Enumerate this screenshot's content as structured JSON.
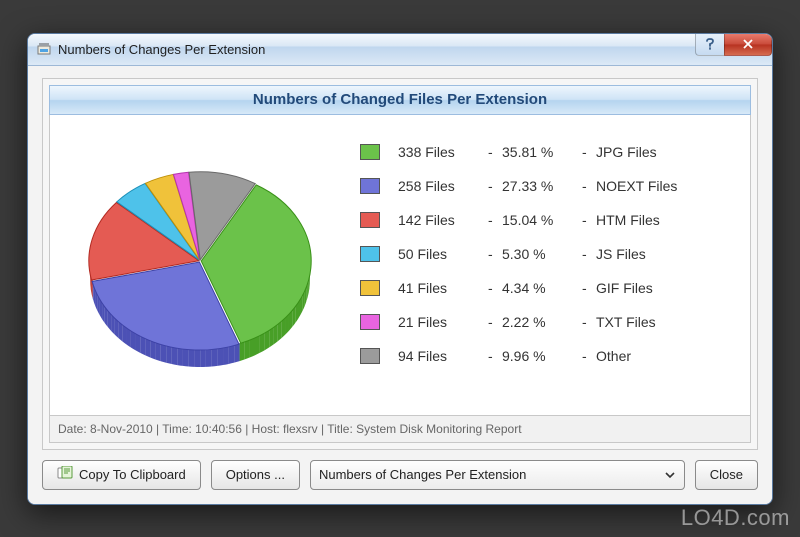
{
  "window": {
    "title": "Numbers of Changes Per Extension"
  },
  "panel": {
    "title": "Numbers of Changed Files Per Extension"
  },
  "colors": {
    "jpg": "#6bc24a",
    "noext": "#6f74d8",
    "htm": "#e45b53",
    "js": "#4ec2ea",
    "gif": "#f0c23a",
    "txt": "#e964e0",
    "other": "#9b9b9b"
  },
  "chart_data": {
    "type": "pie",
    "title": "Numbers of Changed Files Per Extension",
    "series": [
      {
        "key": "jpg",
        "files": 338,
        "files_label": "338 Files",
        "pct": 35.81,
        "pct_label": "35.81 %",
        "label": "JPG Files"
      },
      {
        "key": "noext",
        "files": 258,
        "files_label": "258 Files",
        "pct": 27.33,
        "pct_label": "27.33 %",
        "label": "NOEXT Files"
      },
      {
        "key": "htm",
        "files": 142,
        "files_label": "142 Files",
        "pct": 15.04,
        "pct_label": "15.04 %",
        "label": "HTM Files"
      },
      {
        "key": "js",
        "files": 50,
        "files_label": "50 Files",
        "pct": 5.3,
        "pct_label": "5.30 %",
        "label": "JS Files"
      },
      {
        "key": "gif",
        "files": 41,
        "files_label": "41 Files",
        "pct": 4.34,
        "pct_label": "4.34 %",
        "label": "GIF Files"
      },
      {
        "key": "txt",
        "files": 21,
        "files_label": "21 Files",
        "pct": 2.22,
        "pct_label": "2.22 %",
        "label": "TXT Files"
      },
      {
        "key": "other",
        "files": 94,
        "files_label": "94 Files",
        "pct": 9.96,
        "pct_label": "9.96 %",
        "label": "Other"
      }
    ]
  },
  "status": {
    "date_label": "Date:",
    "date": "8-Nov-2010",
    "time_label": "Time:",
    "time": "10:40:56",
    "host_label": "Host:",
    "host": "flexsrv",
    "title_label": "Title:",
    "title": "System Disk Monitoring Report",
    "full": "Date: 8-Nov-2010 | Time: 10:40:56 | Host: flexsrv | Title: System Disk Monitoring Report"
  },
  "buttons": {
    "copy": "Copy To Clipboard",
    "options": "Options ...",
    "close": "Close"
  },
  "combo": {
    "selected": "Numbers of Changes Per Extension"
  },
  "watermark": "LO4D.com"
}
